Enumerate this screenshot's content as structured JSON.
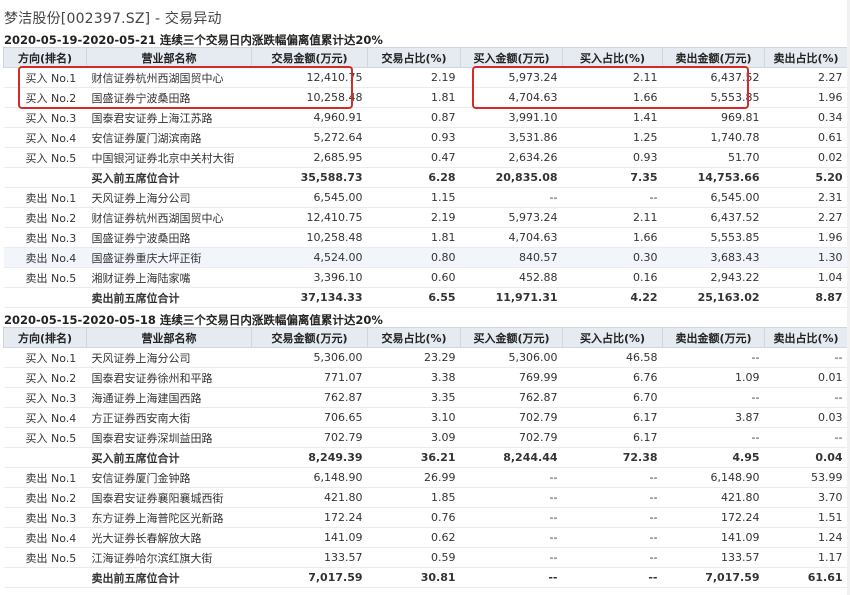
{
  "title": "梦洁股份[002397.SZ] - 交易异动",
  "columns": [
    "方向(排名)",
    "营业部名称",
    "交易金额(万元)",
    "交易占比(%)",
    "买入金额(万元)",
    "买入占比(%)",
    "卖出金额(万元)",
    "卖出占比(%)"
  ],
  "section1": {
    "title": "2020-05-19-2020-05-21 连续三个交易日内涨跌幅偏离值累计达20%",
    "rows": [
      {
        "dir": "买入 No.1",
        "branch": "财信证券杭州西湖国贸中心",
        "amount": "12,410.75",
        "ratio": "2.19",
        "buy": "5,973.24",
        "buy_ratio": "2.11",
        "sell": "6,437.52",
        "sell_ratio": "2.27"
      },
      {
        "dir": "买入 No.2",
        "branch": "国盛证券宁波桑田路",
        "amount": "10,258.48",
        "ratio": "1.81",
        "buy": "4,704.63",
        "buy_ratio": "1.66",
        "sell": "5,553.85",
        "sell_ratio": "1.96"
      },
      {
        "dir": "买入 No.3",
        "branch": "国泰君安证券上海江苏路",
        "amount": "4,960.91",
        "ratio": "0.87",
        "buy": "3,991.10",
        "buy_ratio": "1.41",
        "sell": "969.81",
        "sell_ratio": "0.34"
      },
      {
        "dir": "买入 No.4",
        "branch": "安信证券厦门湖滨南路",
        "amount": "5,272.64",
        "ratio": "0.93",
        "buy": "3,531.86",
        "buy_ratio": "1.25",
        "sell": "1,740.78",
        "sell_ratio": "0.61"
      },
      {
        "dir": "买入 No.5",
        "branch": "中国银河证券北京中关村大街",
        "amount": "2,685.95",
        "ratio": "0.47",
        "buy": "2,634.26",
        "buy_ratio": "0.93",
        "sell": "51.70",
        "sell_ratio": "0.02"
      },
      {
        "dir": "",
        "branch": "买入前五席位合计",
        "amount": "35,588.73",
        "ratio": "6.28",
        "buy": "20,835.08",
        "buy_ratio": "7.35",
        "sell": "14,753.66",
        "sell_ratio": "5.20",
        "total": true
      },
      {
        "dir": "卖出 No.1",
        "branch": "天风证券上海分公司",
        "amount": "6,545.00",
        "ratio": "1.15",
        "buy": "--",
        "buy_ratio": "--",
        "sell": "6,545.00",
        "sell_ratio": "2.31"
      },
      {
        "dir": "卖出 No.2",
        "branch": "财信证券杭州西湖国贸中心",
        "amount": "12,410.75",
        "ratio": "2.19",
        "buy": "5,973.24",
        "buy_ratio": "2.11",
        "sell": "6,437.52",
        "sell_ratio": "2.27"
      },
      {
        "dir": "卖出 No.3",
        "branch": "国盛证券宁波桑田路",
        "amount": "10,258.48",
        "ratio": "1.81",
        "buy": "4,704.63",
        "buy_ratio": "1.66",
        "sell": "5,553.85",
        "sell_ratio": "1.96"
      },
      {
        "dir": "卖出 No.4",
        "branch": "国盛证券重庆大坪正街",
        "amount": "4,524.00",
        "ratio": "0.80",
        "buy": "840.57",
        "buy_ratio": "0.30",
        "sell": "3,683.43",
        "sell_ratio": "1.30",
        "highlight": true
      },
      {
        "dir": "卖出 No.5",
        "branch": "湘财证券上海陆家嘴",
        "amount": "3,396.10",
        "ratio": "0.60",
        "buy": "452.88",
        "buy_ratio": "0.16",
        "sell": "2,943.22",
        "sell_ratio": "1.04"
      },
      {
        "dir": "",
        "branch": "卖出前五席位合计",
        "amount": "37,134.33",
        "ratio": "6.55",
        "buy": "11,971.31",
        "buy_ratio": "4.22",
        "sell": "25,163.02",
        "sell_ratio": "8.87",
        "total": true
      }
    ]
  },
  "section2": {
    "title": "2020-05-15-2020-05-18 连续三个交易日内涨跌幅偏离值累计达20%",
    "rows": [
      {
        "dir": "买入 No.1",
        "branch": "天风证券上海分公司",
        "amount": "5,306.00",
        "ratio": "23.29",
        "buy": "5,306.00",
        "buy_ratio": "46.58",
        "sell": "--",
        "sell_ratio": "--"
      },
      {
        "dir": "买入 No.2",
        "branch": "国泰君安证券徐州和平路",
        "amount": "771.07",
        "ratio": "3.38",
        "buy": "769.99",
        "buy_ratio": "6.76",
        "sell": "1.09",
        "sell_ratio": "0.01"
      },
      {
        "dir": "买入 No.3",
        "branch": "海通证券上海建国西路",
        "amount": "762.87",
        "ratio": "3.35",
        "buy": "762.87",
        "buy_ratio": "6.70",
        "sell": "--",
        "sell_ratio": "--"
      },
      {
        "dir": "买入 No.4",
        "branch": "方正证券西安南大街",
        "amount": "706.65",
        "ratio": "3.10",
        "buy": "702.79",
        "buy_ratio": "6.17",
        "sell": "3.87",
        "sell_ratio": "0.03"
      },
      {
        "dir": "买入 No.5",
        "branch": "国泰君安证券深圳益田路",
        "amount": "702.79",
        "ratio": "3.09",
        "buy": "702.79",
        "buy_ratio": "6.17",
        "sell": "--",
        "sell_ratio": "--"
      },
      {
        "dir": "",
        "branch": "买入前五席位合计",
        "amount": "8,249.39",
        "ratio": "36.21",
        "buy": "8,244.44",
        "buy_ratio": "72.38",
        "sell": "4.95",
        "sell_ratio": "0.04",
        "total": true
      },
      {
        "dir": "卖出 No.1",
        "branch": "安信证券厦门金钟路",
        "amount": "6,148.90",
        "ratio": "26.99",
        "buy": "--",
        "buy_ratio": "--",
        "sell": "6,148.90",
        "sell_ratio": "53.99"
      },
      {
        "dir": "卖出 No.2",
        "branch": "国泰君安证券襄阳襄城西街",
        "amount": "421.80",
        "ratio": "1.85",
        "buy": "--",
        "buy_ratio": "--",
        "sell": "421.80",
        "sell_ratio": "3.70"
      },
      {
        "dir": "卖出 No.3",
        "branch": "东方证券上海普陀区光新路",
        "amount": "172.24",
        "ratio": "0.76",
        "buy": "--",
        "buy_ratio": "--",
        "sell": "172.24",
        "sell_ratio": "1.51"
      },
      {
        "dir": "卖出 No.4",
        "branch": "光大证券长春解放大路",
        "amount": "141.09",
        "ratio": "0.62",
        "buy": "--",
        "buy_ratio": "--",
        "sell": "141.09",
        "sell_ratio": "1.24"
      },
      {
        "dir": "卖出 No.5",
        "branch": "江海证券哈尔滨红旗大街",
        "amount": "133.57",
        "ratio": "0.59",
        "buy": "--",
        "buy_ratio": "--",
        "sell": "133.57",
        "sell_ratio": "1.17"
      },
      {
        "dir": "",
        "branch": "卖出前五席位合计",
        "amount": "7,017.59",
        "ratio": "30.81",
        "buy": "--",
        "buy_ratio": "--",
        "sell": "7,017.59",
        "sell_ratio": "61.61",
        "total": true
      }
    ]
  },
  "colors": {
    "highlight_box": "#d42a2a",
    "header_bg": "#e6ebf1"
  }
}
